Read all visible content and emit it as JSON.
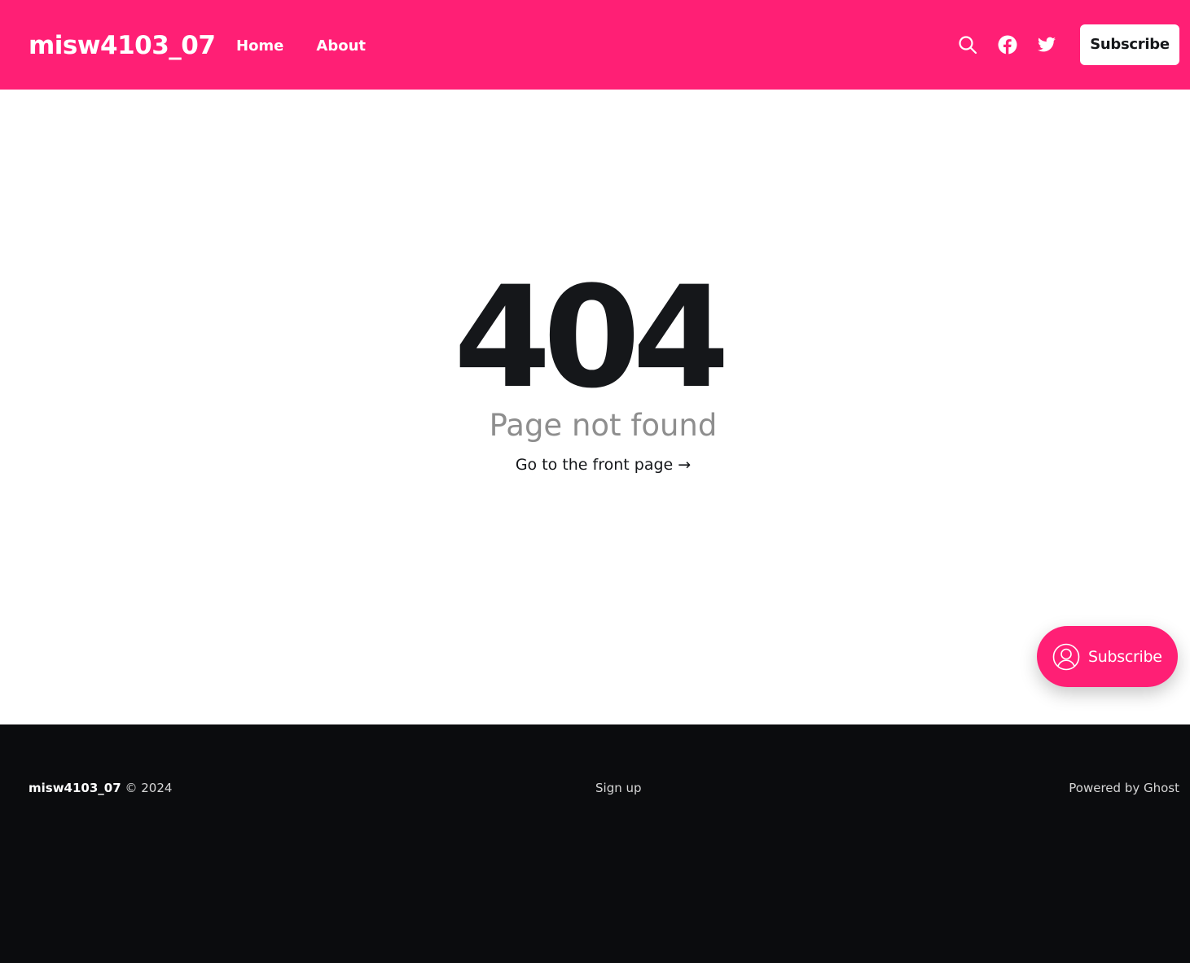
{
  "header": {
    "site_title": "misw4103_07",
    "nav": [
      {
        "label": "Home"
      },
      {
        "label": "About"
      }
    ],
    "icons": {
      "search": "search-icon",
      "facebook": "facebook-icon",
      "twitter": "twitter-icon"
    },
    "subscribe_label": "Subscribe"
  },
  "error": {
    "code": "404",
    "message": "Page not found",
    "link_label": "Go to the front page →"
  },
  "portal": {
    "label": "Subscribe",
    "icon": "user-circle-icon"
  },
  "footer": {
    "brand": "misw4103_07",
    "copyright": "© 2024",
    "signup_label": "Sign up",
    "powered_label": "Powered by Ghost"
  },
  "colors": {
    "accent": "#ff1f75",
    "text_dark": "#15171a",
    "footer_bg": "#0b0c0e",
    "muted": "#8e8e8e"
  }
}
